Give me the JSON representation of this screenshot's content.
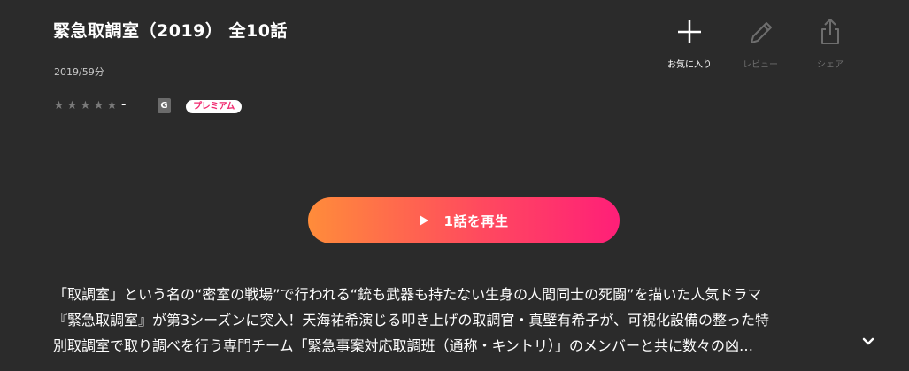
{
  "title": "緊急取調室（2019） 全10話",
  "meta": "2019/59分",
  "rating": {
    "stars": [
      "★",
      "★",
      "★",
      "★",
      "★"
    ],
    "score": "-"
  },
  "badges": {
    "age_rating": "G",
    "premium": "プレミアム"
  },
  "actions": {
    "favorite": {
      "label": "お気に入り",
      "icon": "plus-icon"
    },
    "review": {
      "label": "レビュー",
      "icon": "pencil-icon"
    },
    "share": {
      "label": "シェア",
      "icon": "share-icon"
    }
  },
  "play_button": {
    "label": "1話を再生",
    "icon": "play-icon"
  },
  "description": {
    "lines": [
      "「取調室」という名の“密室の戦場”で行われる“銃も武器も持たない生身の人間同士の死闘”を描いた人気ドラマ",
      "『緊急取調室』が第3シーズンに突入！天海祐希演じる叩き上げの取調官・真壁有希子が、可視化設備の整った特",
      "別取調室で取り調べを行う専門チーム「緊急事案対応取調班（通称・キントリ）」のメンバーと共に数々の凶…"
    ],
    "expand_icon": "chevron-down-icon"
  },
  "colors": {
    "background": "#2b2b2b",
    "button_gradient_start": "#ff8c3a",
    "button_gradient_end": "#ff1f78",
    "premium_text": "#f0286e",
    "disabled_text": "#6e6e6e"
  }
}
